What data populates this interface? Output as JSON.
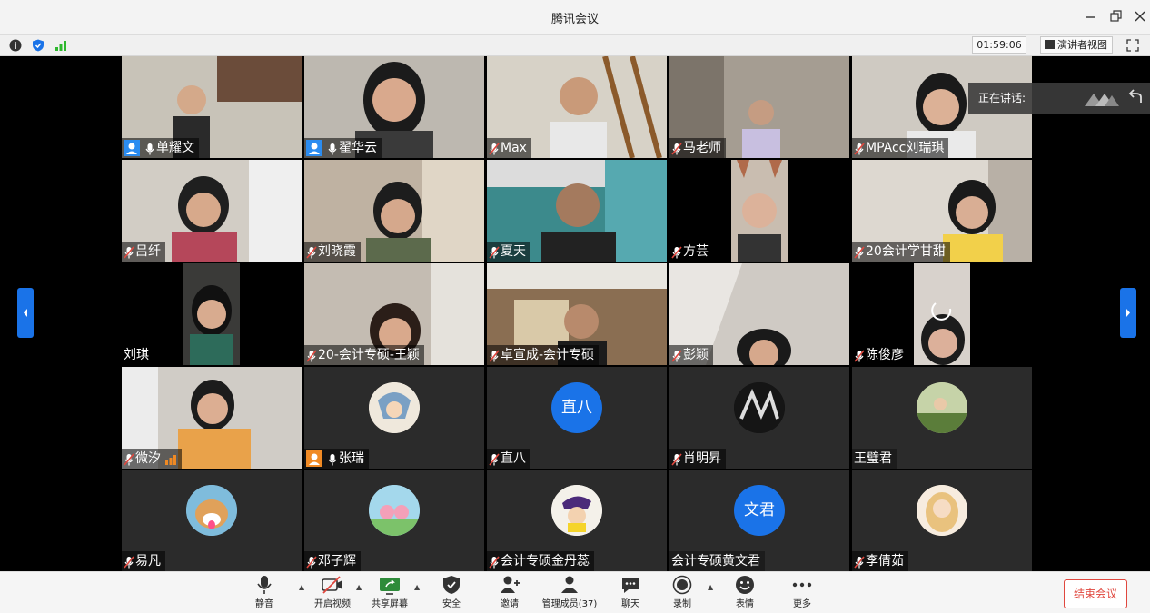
{
  "window": {
    "title": "腾讯会议"
  },
  "toolbar": {
    "timer": "01:59:06",
    "speaker_view_label": "演讲者视图"
  },
  "speaking": {
    "label": "正在讲话:"
  },
  "participants": [
    {
      "name": "单耀文",
      "host": true,
      "mic": true
    },
    {
      "name": "翟华云",
      "host": true,
      "mic": true
    },
    {
      "name": "Max"
    },
    {
      "name": "马老师"
    },
    {
      "name": "MPAcc刘瑞琪"
    },
    {
      "name": "吕纤"
    },
    {
      "name": "刘晓霞"
    },
    {
      "name": "夏天"
    },
    {
      "name": "方芸"
    },
    {
      "name": "20会计学甘甜"
    },
    {
      "name": "刘琪"
    },
    {
      "name": "20-会计专硕-王颖"
    },
    {
      "name": "卓宣成-会计专硕"
    },
    {
      "name": "彭颖"
    },
    {
      "name": "陈俊彦"
    },
    {
      "name": "微汐"
    },
    {
      "name": "张瑞"
    },
    {
      "name": "直八",
      "avatar_text": "直八"
    },
    {
      "name": "肖明昇"
    },
    {
      "name": "王璧君"
    },
    {
      "name": "易凡"
    },
    {
      "name": "邓子辉"
    },
    {
      "name": "会计专硕金丹蕊"
    },
    {
      "name": "会计专硕黄文君",
      "avatar_text": "文君"
    },
    {
      "name": "李倩茹"
    }
  ],
  "bottom": {
    "mute": "静音",
    "video": "开启视频",
    "share": "共享屏幕",
    "security": "安全",
    "invite": "邀请",
    "members": "管理成员(37)",
    "chat": "聊天",
    "record": "录制",
    "reaction": "表情",
    "more": "更多",
    "end": "结束会议"
  },
  "colors": {
    "accent": "#1a73e8",
    "end": "#e0473e",
    "host": "#2b8cf0"
  }
}
